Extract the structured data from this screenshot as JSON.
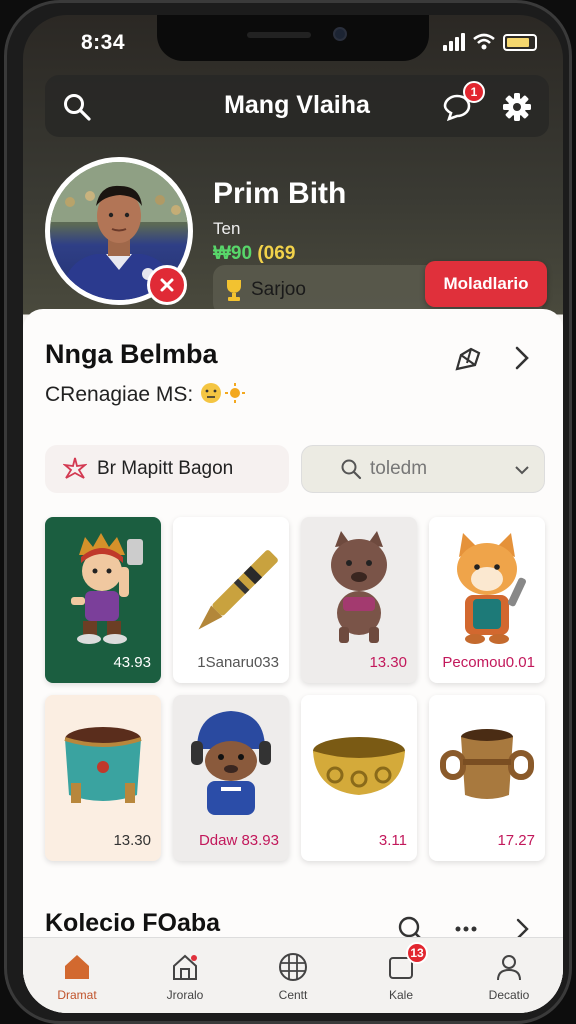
{
  "status": {
    "time": "8:34"
  },
  "header": {
    "title": "Mang Vlaiha",
    "notification_count": "1"
  },
  "profile": {
    "name": "Prim Bith",
    "role": "Ten",
    "value_a": "₩90",
    "value_b": "(069",
    "tag_label": "Sarjoo",
    "action_label": "Moladlario"
  },
  "section": {
    "title": "Nnga Belmba",
    "subtitle": "CRenagiae MS:"
  },
  "filter": {
    "label": "Br Mapitt Bagon"
  },
  "search": {
    "value": "toledm"
  },
  "items": [
    {
      "price": "43.93",
      "icon": "warrior-figure"
    },
    {
      "price": "1Sanaru033",
      "icon": "golden-pen"
    },
    {
      "price": "13.30",
      "icon": "bear-figure"
    },
    {
      "price": "Pecomou0.01",
      "icon": "fox-figure"
    },
    {
      "price": "13.30",
      "icon": "teal-cup"
    },
    {
      "price": "Ddaw  83.93",
      "icon": "helmet-bear"
    },
    {
      "price": "3.11",
      "icon": "gold-bowl"
    },
    {
      "price": "17.27",
      "icon": "bronze-pot"
    }
  ],
  "collection": {
    "title": "Kolecio FOaba"
  },
  "tabs": [
    {
      "label": "Dramat",
      "icon": "home-icon"
    },
    {
      "label": "Jroralo",
      "icon": "store-icon"
    },
    {
      "label": "Centt",
      "icon": "globe-icon"
    },
    {
      "label": "Kale",
      "icon": "inbox-icon",
      "badge": "13"
    },
    {
      "label": "Decatio",
      "icon": "user-icon"
    }
  ],
  "colors": {
    "accent": "#e0303b",
    "active_tab": "#c0532b",
    "price": "#c2185b"
  }
}
